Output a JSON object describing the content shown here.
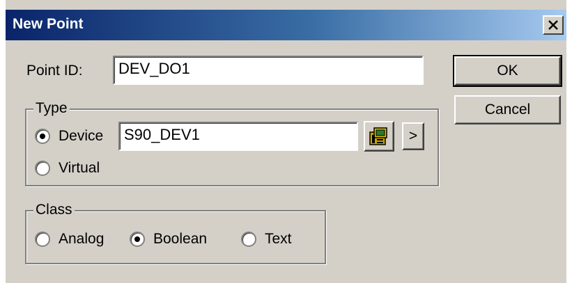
{
  "window": {
    "title": "New Point",
    "close_symbol": "x"
  },
  "point_id": {
    "label": "Point ID:",
    "value": "DEV_DO1"
  },
  "buttons": {
    "ok": "OK",
    "cancel": "Cancel",
    "arrow": ">"
  },
  "type_group": {
    "title": "Type",
    "device_label": "Device",
    "device_value": "S90_DEV1",
    "virtual_label": "Virtual",
    "selected": "Device",
    "browse_icon": "device-browse-icon"
  },
  "class_group": {
    "title": "Class",
    "analog_label": "Analog",
    "boolean_label": "Boolean",
    "text_label": "Text",
    "selected": "Boolean"
  }
}
